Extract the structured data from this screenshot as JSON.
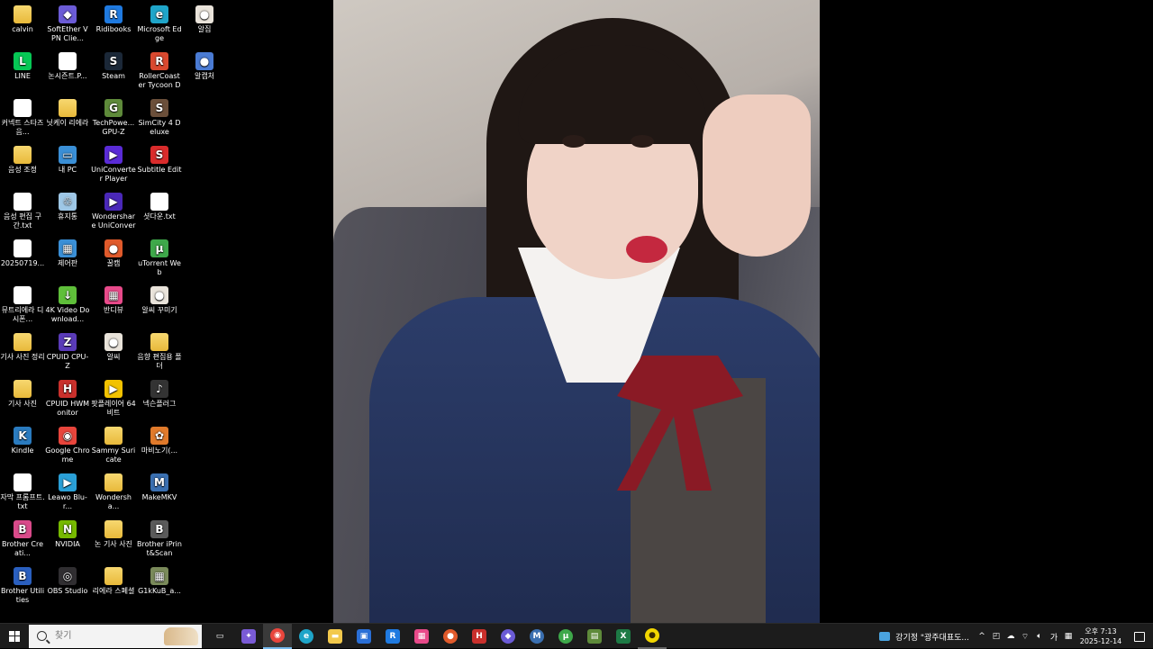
{
  "desktop": {
    "icons": [
      {
        "label": "calvin",
        "glyph": "",
        "color": "#f2c94c",
        "kind": "folder"
      },
      {
        "label": "SoftEther VPN Clie...",
        "glyph": "◆",
        "color": "#6b5bd6",
        "kind": "app"
      },
      {
        "label": "Ridibooks",
        "glyph": "R",
        "color": "#1f7ae0",
        "kind": "app"
      },
      {
        "label": "Microsoft Edge",
        "glyph": "e",
        "color": "#1fa5c9",
        "kind": "app"
      },
      {
        "label": "알집",
        "glyph": "●",
        "color": "#e9e3da",
        "kind": "app"
      },
      {
        "label": "LINE",
        "glyph": "L",
        "color": "#06c755",
        "kind": "app"
      },
      {
        "label": "논시즌트.P...",
        "glyph": "",
        "color": "#ffffff",
        "kind": "file"
      },
      {
        "label": "Steam",
        "glyph": "S",
        "color": "#1b2838",
        "kind": "app"
      },
      {
        "label": "RollerCoaster Tycoon Del...",
        "glyph": "R",
        "color": "#d9492f",
        "kind": "app"
      },
      {
        "label": "알캡처",
        "glyph": "●",
        "color": "#4a7bd4",
        "kind": "app"
      },
      {
        "label": "커넥트 스타즈 음...",
        "glyph": "",
        "color": "#ffffff",
        "kind": "file"
      },
      {
        "label": "닛케이 리에라",
        "glyph": "",
        "color": "#f2c94c",
        "kind": "folder"
      },
      {
        "label": "TechPowe... GPU-Z",
        "glyph": "G",
        "color": "#5e8a3a",
        "kind": "app"
      },
      {
        "label": "SimCity 4 Deluxe",
        "glyph": "S",
        "color": "#6b4f3a",
        "kind": "app"
      },
      {
        "label": "음성 조정",
        "glyph": "",
        "color": "#f2c94c",
        "kind": "folder"
      },
      {
        "label": "내 PC",
        "glyph": "▭",
        "color": "#3a8fd6",
        "kind": "app"
      },
      {
        "label": "UniConverter Player",
        "glyph": "▶",
        "color": "#5a2bd6",
        "kind": "app"
      },
      {
        "label": "Subtitle Edit",
        "glyph": "S",
        "color": "#d92b2b",
        "kind": "app"
      },
      {
        "label": "음성 편집 구간.txt",
        "glyph": "",
        "color": "#ffffff",
        "kind": "file"
      },
      {
        "label": "휴지통",
        "glyph": "♲",
        "color": "#9ec7e6",
        "kind": "app"
      },
      {
        "label": "Wondershare UniConvert...",
        "glyph": "▶",
        "color": "#4a28b8",
        "kind": "app"
      },
      {
        "label": "셧다운.txt",
        "glyph": "",
        "color": "#ffffff",
        "kind": "file"
      },
      {
        "label": "20250719...",
        "glyph": "",
        "color": "#ffffff",
        "kind": "file"
      },
      {
        "label": "제어판",
        "glyph": "▦",
        "color": "#3a8fd6",
        "kind": "app"
      },
      {
        "label": "꿀캠",
        "glyph": "●",
        "color": "#e05a2b",
        "kind": "app"
      },
      {
        "label": "uTorrent Web",
        "glyph": "μ",
        "color": "#3ea84a",
        "kind": "app"
      },
      {
        "label": "뮤트리에라 디시폰...",
        "glyph": "",
        "color": "#ffffff",
        "kind": "file"
      },
      {
        "label": "4K Video Download...",
        "glyph": "↓",
        "color": "#5fbf3a",
        "kind": "app"
      },
      {
        "label": "반디뷰",
        "glyph": "▦",
        "color": "#e84a8a",
        "kind": "app"
      },
      {
        "label": "알씨 꾸미기",
        "glyph": "●",
        "color": "#e9e3da",
        "kind": "app"
      },
      {
        "label": "기사 사진 정리",
        "glyph": "",
        "color": "#f2c94c",
        "kind": "folder"
      },
      {
        "label": "CPUID CPU-Z",
        "glyph": "Z",
        "color": "#5a3bb8",
        "kind": "app"
      },
      {
        "label": "알씨",
        "glyph": "●",
        "color": "#e9e3da",
        "kind": "app"
      },
      {
        "label": "음향 편집용 폴더",
        "glyph": "",
        "color": "#f2c94c",
        "kind": "folder"
      },
      {
        "label": "기사 사진",
        "glyph": "",
        "color": "#f2c94c",
        "kind": "folder"
      },
      {
        "label": "CPUID HWMonitor",
        "glyph": "H",
        "color": "#c9302c",
        "kind": "app"
      },
      {
        "label": "팟플레이어 64 비트",
        "glyph": "▶",
        "color": "#f2c200",
        "kind": "app"
      },
      {
        "label": "넥슨플러그",
        "glyph": "♪",
        "color": "#333333",
        "kind": "app"
      },
      {
        "label": "Kindle",
        "glyph": "K",
        "color": "#2a7bbf",
        "kind": "app"
      },
      {
        "label": "Google Chrome",
        "glyph": "◉",
        "color": "#e8453c",
        "kind": "app"
      },
      {
        "label": "Sammy Suricate",
        "glyph": "",
        "color": "#f2c94c",
        "kind": "folder"
      },
      {
        "label": "마비노기(...",
        "glyph": "✿",
        "color": "#e07a2b",
        "kind": "app"
      },
      {
        "label": "자막 프롬프트.txt",
        "glyph": "",
        "color": "#ffffff",
        "kind": "file"
      },
      {
        "label": "Leawo Blu-r...",
        "glyph": "▶",
        "color": "#2a9fd6",
        "kind": "app"
      },
      {
        "label": "Wondersha...",
        "glyph": "",
        "color": "#f2c94c",
        "kind": "folder"
      },
      {
        "label": "MakeMKV",
        "glyph": "M",
        "color": "#3a6fb0",
        "kind": "app"
      },
      {
        "label": "Brother Creati...",
        "glyph": "B",
        "color": "#d94a8a",
        "kind": "app"
      },
      {
        "label": "NVIDIA",
        "glyph": "N",
        "color": "#76b900",
        "kind": "app"
      },
      {
        "label": "논 기사 사진",
        "glyph": "",
        "color": "#f2c94c",
        "kind": "folder"
      },
      {
        "label": "Brother iPrint&Scan",
        "glyph": "B",
        "color": "#5a5a5a",
        "kind": "app"
      },
      {
        "label": "Brother Utilities",
        "glyph": "B",
        "color": "#2a5fbf",
        "kind": "app"
      },
      {
        "label": "OBS Studio",
        "glyph": "◎",
        "color": "#302e31",
        "kind": "app"
      },
      {
        "label": "리에라 스페셜",
        "glyph": "",
        "color": "#f2c94c",
        "kind": "folder"
      },
      {
        "label": "G1kKuB_a...",
        "glyph": "▦",
        "color": "#7a8a5a",
        "kind": "app"
      }
    ]
  },
  "taskbar": {
    "search_placeholder": "찾기",
    "apps": [
      {
        "name": "task-view",
        "glyph": "▭",
        "color": "#1c1c1c",
        "state": ""
      },
      {
        "name": "copilot",
        "glyph": "✦",
        "color": "#7a5bd6",
        "state": ""
      },
      {
        "name": "chrome",
        "glyph": "◉",
        "color": "#e8453c",
        "state": "active"
      },
      {
        "name": "edge",
        "glyph": "e",
        "color": "#1fa5c9",
        "state": ""
      },
      {
        "name": "file-explorer",
        "glyph": "▬",
        "color": "#f2c94c",
        "state": ""
      },
      {
        "name": "store",
        "glyph": "▣",
        "color": "#2a6fd6",
        "state": ""
      },
      {
        "name": "ridibooks",
        "glyph": "R",
        "color": "#1f7ae0",
        "state": ""
      },
      {
        "name": "bandiview",
        "glyph": "▦",
        "color": "#e84a8a",
        "state": ""
      },
      {
        "name": "kkulcam",
        "glyph": "●",
        "color": "#e05a2b",
        "state": ""
      },
      {
        "name": "hwmonitor",
        "glyph": "H",
        "color": "#c9302c",
        "state": ""
      },
      {
        "name": "softether",
        "glyph": "◆",
        "color": "#6b5bd6",
        "state": ""
      },
      {
        "name": "makemkv",
        "glyph": "M",
        "color": "#3a6fb0",
        "state": ""
      },
      {
        "name": "utorrent",
        "glyph": "μ",
        "color": "#3ea84a",
        "state": ""
      },
      {
        "name": "notepad",
        "glyph": "▤",
        "color": "#5e8a3a",
        "state": ""
      },
      {
        "name": "excel",
        "glyph": "X",
        "color": "#1d7a45",
        "state": ""
      },
      {
        "name": "kakaotalk",
        "glyph": "●",
        "color": "#f2d600",
        "state": "pinned"
      }
    ],
    "notification_text": "강기정 \"광주대표도...",
    "tray": {
      "chevron": "^",
      "ime": "가",
      "time": "오후 7:13",
      "date": "2025-12-14"
    }
  }
}
